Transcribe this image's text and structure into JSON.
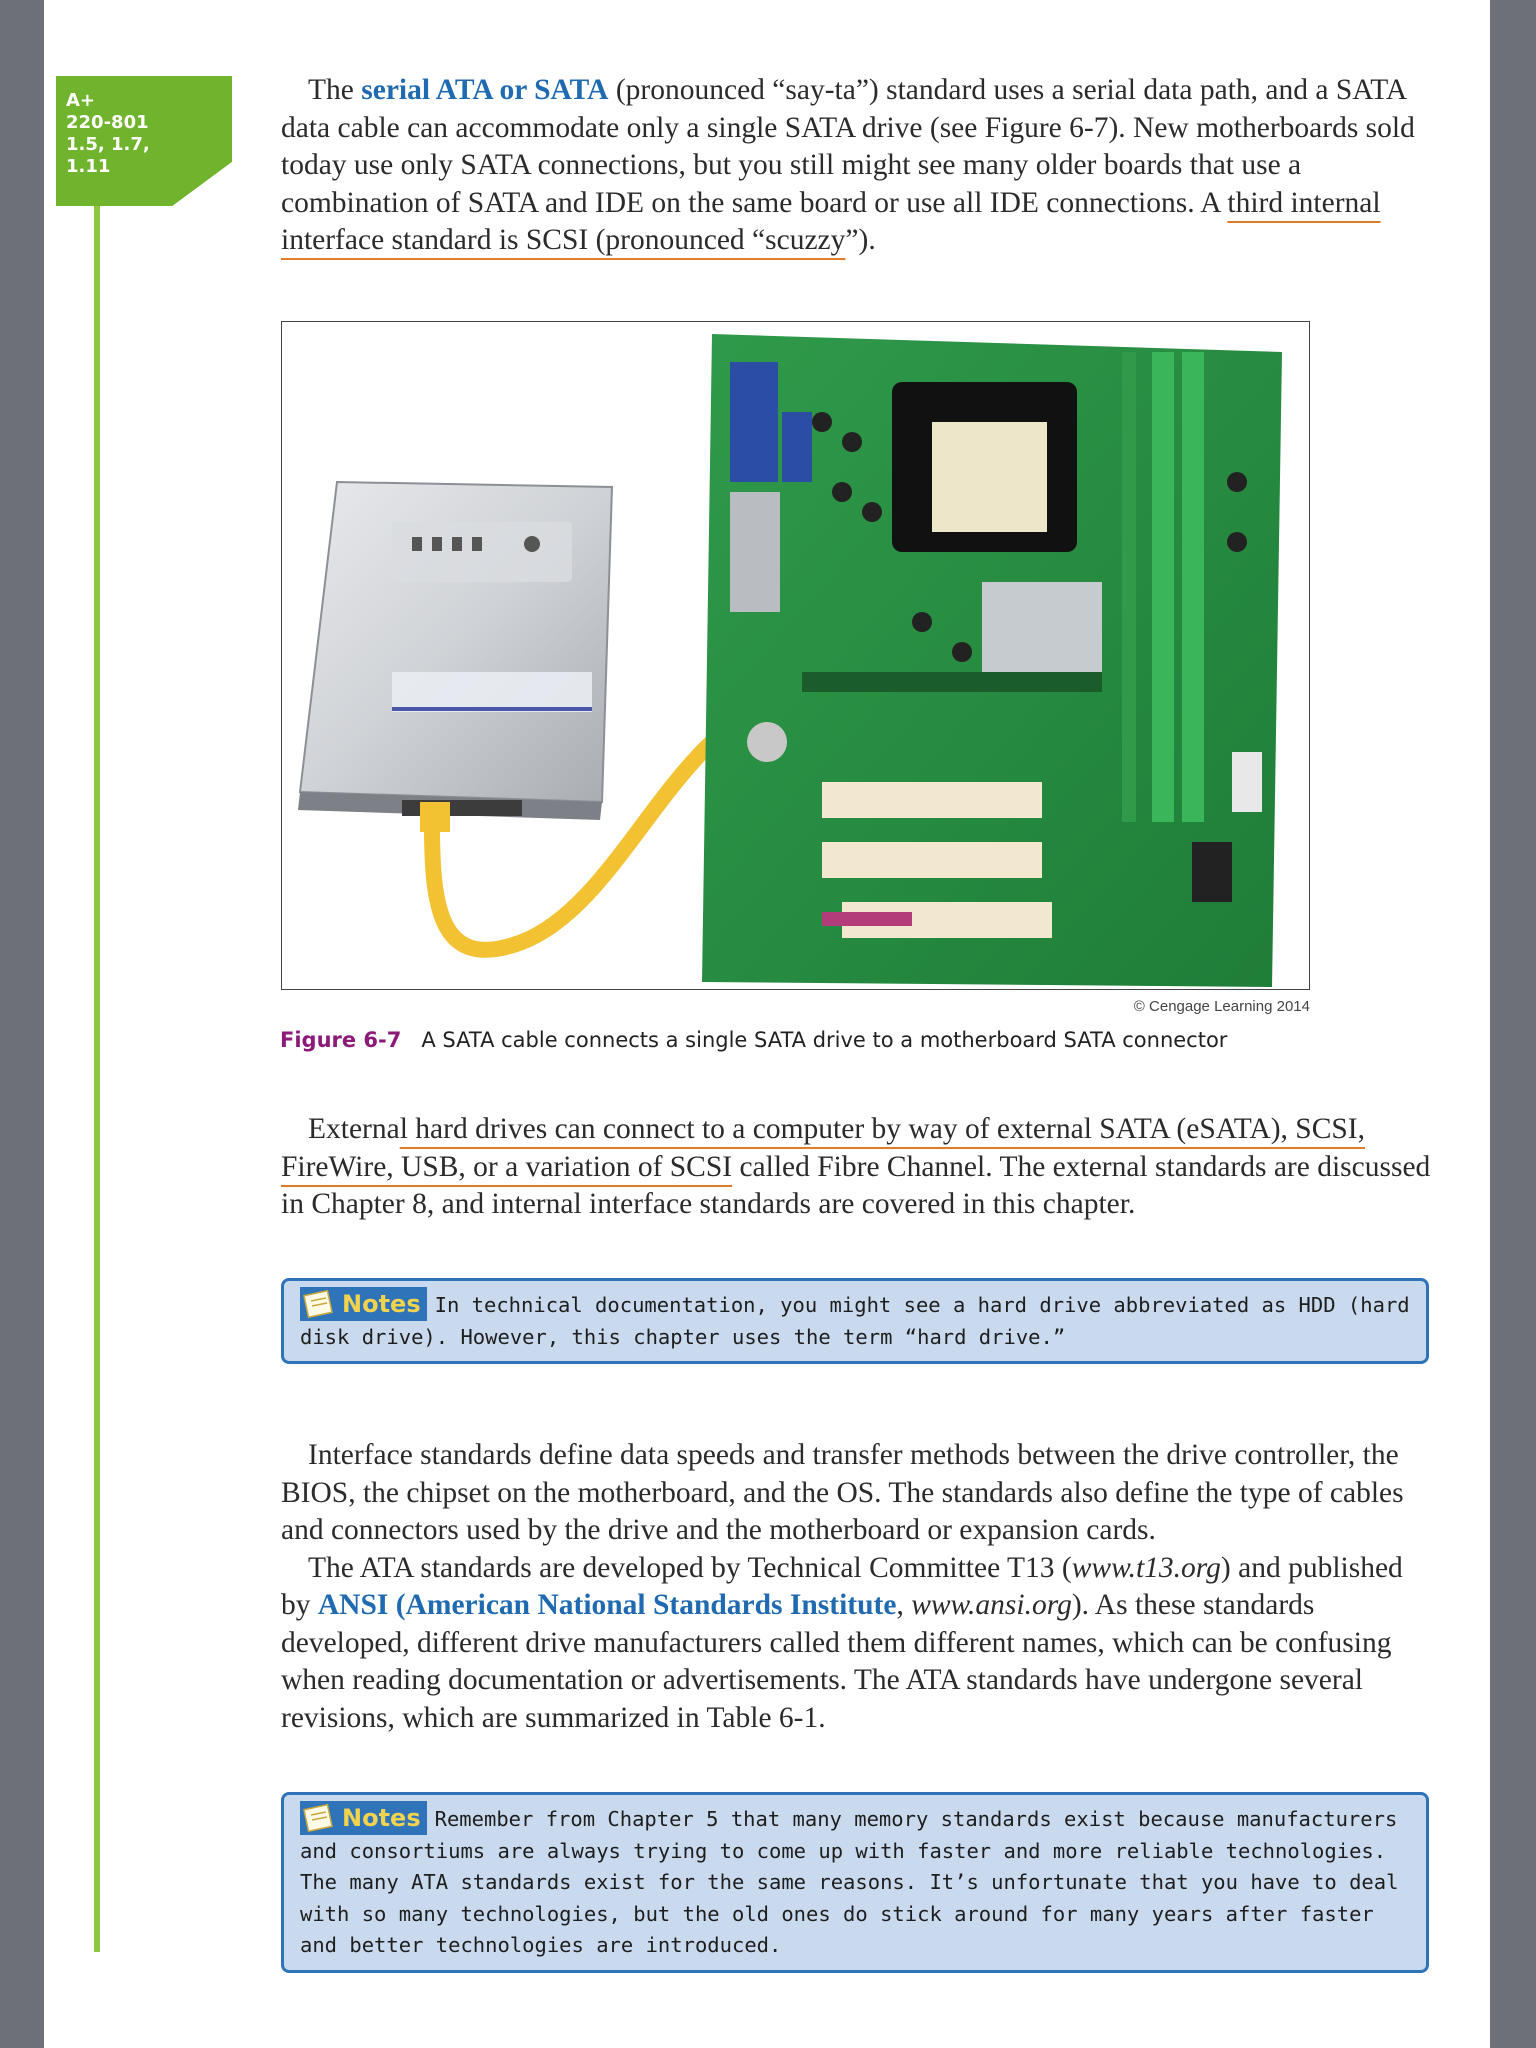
{
  "badge": {
    "lines": [
      "A+",
      "220-801",
      "1.5, 1.7,",
      "1.11"
    ]
  },
  "para1": {
    "pre": "The ",
    "keyword": "serial ATA or SATA",
    "t1": " (pronounced “say-ta”) standard uses a serial data path, and a SATA data cable can accommodate only a single SATA drive (see Figure 6-7). New motherboards sold today use only SATA connections, but you still might see many older boards that use a combination of SATA and IDE on the same board or use all IDE connections. A ",
    "underlined": "third internal interface standard is SCSI (pronounced “scuzzy",
    "t2": "”)."
  },
  "figure": {
    "credit": "© Cengage Learning 2014",
    "label": "Figure 6-7",
    "caption": "A SATA cable connects a single SATA drive to a motherboard SATA connector"
  },
  "para2": {
    "t1": "Externa",
    "underlined": "l hard drives can connect to a computer by way of external SATA (eSATA), SCSI, FireWire, USB, or a variation of SCSI",
    "t2": " called Fibre Channel. The external standards are discussed in Chapter 8, and internal interface standards are covered in this chapter."
  },
  "note1": {
    "tag": "Notes",
    "text": "In technical documentation, you might see a hard drive abbreviated as HDD (hard disk drive). However, this chapter uses the term “hard drive.”"
  },
  "para3": {
    "text": "Interface standards define data speeds and transfer methods between the drive controller, the BIOS, the chipset on the motherboard, and the OS. The standards also define the type of cables and connectors used by the drive and the motherboard or expansion cards."
  },
  "para4": {
    "t1": "The ATA standards are developed by Technical Committee T13 (",
    "url1": "www.t13.org",
    "t2": ") and published by ",
    "keyword": "ANSI (American National Standards Institute",
    "t3": ", ",
    "url2": "www.ansi.org",
    "t4": "). As these standards developed, different drive manufacturers called them different names, which can be confusing when reading documentation or advertisements. The ATA standards have undergone several revisions, which are summarized in Table 6-1."
  },
  "note2": {
    "tag": "Notes",
    "text": "Remember from Chapter 5 that many memory standards exist because manufacturers and consortiums are always trying to come up with faster and more reliable technologies. The many ATA standards exist for the same reasons. It’s unfortunate that you have to deal with so many technologies, but the old ones do stick around for many years after faster and better technologies are introduced."
  },
  "colors": {
    "badge": "#6fb42c",
    "keyword": "#1f6ab0",
    "underline": "#e27a2a",
    "note_bg": "#c9d9ee",
    "note_border": "#2f73b9",
    "figure_label": "#8b1a78"
  }
}
